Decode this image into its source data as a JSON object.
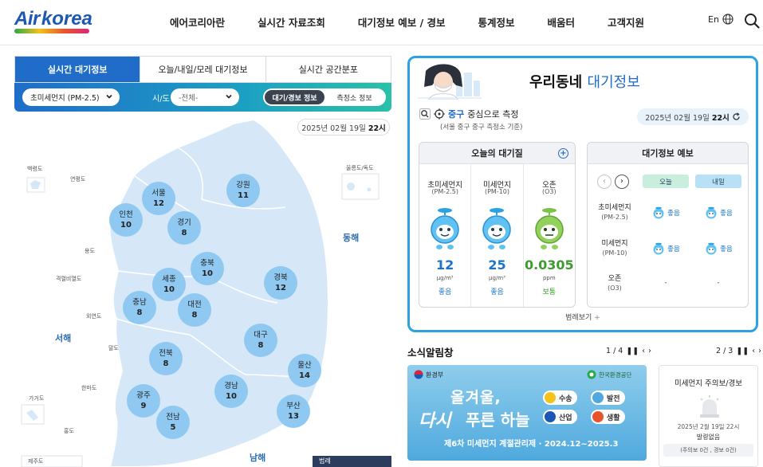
{
  "header": {
    "logo": {
      "air": "Air",
      "korea": "korea"
    },
    "nav": [
      "에어코리아란",
      "실시간 자료조회",
      "대기정보 예보 / 경보",
      "통계정보",
      "배움터",
      "고객지원"
    ],
    "lang_label": "En"
  },
  "map_panel": {
    "tabs": [
      {
        "label": "실시간 대기정보",
        "active": true
      },
      {
        "label": "오늘/내일/모레 대기정보",
        "active": false
      },
      {
        "label": "실시간 공간분포",
        "active": false
      }
    ],
    "pollutant_select": "초미세먼지 (PM-2.5)",
    "sido_label": "시/도",
    "sido_select": "-전체-",
    "toggle": [
      {
        "label": "대기/경보 정보",
        "on": true
      },
      {
        "label": "측정소 정보",
        "on": false
      }
    ],
    "date": "2025년 02월 19일",
    "hour": "22시",
    "regions": [
      {
        "name": "서울",
        "value": "12"
      },
      {
        "name": "강원",
        "value": "11"
      },
      {
        "name": "인천",
        "value": "10"
      },
      {
        "name": "경기",
        "value": "8"
      },
      {
        "name": "충북",
        "value": "10"
      },
      {
        "name": "세종",
        "value": "10"
      },
      {
        "name": "경북",
        "value": "12"
      },
      {
        "name": "충남",
        "value": "8"
      },
      {
        "name": "대전",
        "value": "8"
      },
      {
        "name": "대구",
        "value": "8"
      },
      {
        "name": "전북",
        "value": "8"
      },
      {
        "name": "울산",
        "value": "14"
      },
      {
        "name": "광주",
        "value": "9"
      },
      {
        "name": "경남",
        "value": "10"
      },
      {
        "name": "부산",
        "value": "13"
      },
      {
        "name": "전남",
        "value": "5"
      }
    ],
    "seas": {
      "east": "동해",
      "west": "서해",
      "south": "남해"
    },
    "islands": [
      "백령도",
      "연평도",
      "울릉도/독도",
      "용도",
      "격렬비열도",
      "외연도",
      "말도",
      "한마도",
      "가거도",
      "홍도",
      "제주도"
    ],
    "legend_button": "범례"
  },
  "neighborhood": {
    "title_main": "우리동네",
    "title_hl": "대기정보",
    "location_gu": "중구",
    "location_suffix": "중심으로 측정",
    "location_sub": "(서울 중구 중구 측정소 기준)",
    "date": "2025년 02월 19일",
    "hour": "22시",
    "today": {
      "title": "오늘의 대기질",
      "items": [
        {
          "name": "초미세먼지",
          "unit_label": "(PM-2.5)",
          "value": "12",
          "unit": "μg/m³",
          "grade": "좋음",
          "color": "#1a75c9"
        },
        {
          "name": "미세먼지",
          "unit_label": "(PM-10)",
          "value": "25",
          "unit": "μg/m³",
          "grade": "좋음",
          "color": "#1a75c9"
        },
        {
          "name": "오존",
          "unit_label": "(O3)",
          "value": "0.0305",
          "unit": "ppm",
          "grade": "보통",
          "color": "#3f9a2f"
        }
      ]
    },
    "forecast": {
      "title": "대기정보 예보",
      "days": [
        "오늘",
        "내일"
      ],
      "rows": [
        {
          "name": "초미세먼지",
          "sub": "(PM-2.5)",
          "today": "좋음",
          "tomorrow": "좋음"
        },
        {
          "name": "미세먼지",
          "sub": "(PM-10)",
          "today": "좋음",
          "tomorrow": "좋음"
        },
        {
          "name": "오존",
          "sub": "(O3)",
          "today": "-",
          "tomorrow": "-"
        }
      ]
    },
    "legend_link": "범례보기"
  },
  "news": {
    "title": "소식알림창",
    "pager1": "1 / 4",
    "pager2": "2 / 3",
    "banner": {
      "org1": "환경부",
      "org2": "한국환경공단",
      "headline1": "올겨울,",
      "headline2a": "다시",
      "headline2b": "푸른 하늘",
      "sub": "제6차 미세먼지 계절관리제 · 2024.12~2025.3",
      "chips": [
        "수송",
        "발전",
        "산업",
        "생활"
      ]
    },
    "alert": {
      "title": "미세먼지 주의보/경보",
      "date": "2025년 2월 19일 22시",
      "status": "발령없음",
      "counts": "(주의보 0건 , 경보 0건)"
    }
  }
}
